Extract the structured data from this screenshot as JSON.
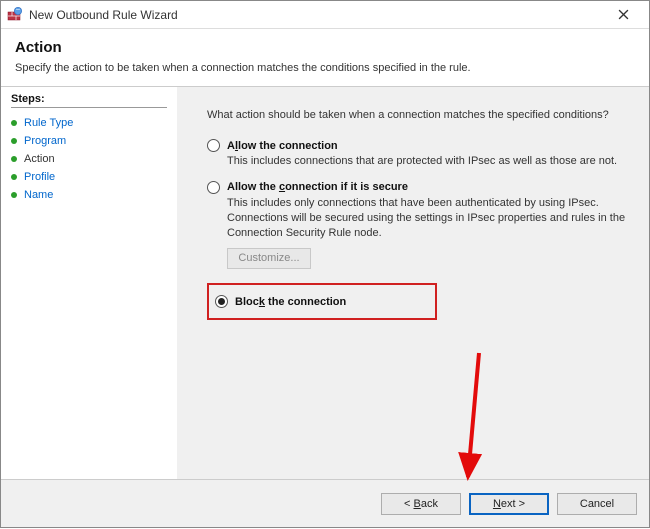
{
  "window": {
    "title": "New Outbound Rule Wizard"
  },
  "header": {
    "title": "Action",
    "subtitle": "Specify the action to be taken when a connection matches the conditions specified in the rule."
  },
  "sidebar": {
    "title": "Steps:",
    "items": [
      {
        "label": "Rule Type",
        "current": false
      },
      {
        "label": "Program",
        "current": false
      },
      {
        "label": "Action",
        "current": true
      },
      {
        "label": "Profile",
        "current": false
      },
      {
        "label": "Name",
        "current": false
      }
    ]
  },
  "main": {
    "question": "What action should be taken when a connection matches the specified conditions?",
    "options": {
      "allow": {
        "title_pre": "A",
        "title_accel": "l",
        "title_post": "low the connection",
        "desc": "This includes connections that are protected with IPsec as well as those are not."
      },
      "allow_secure": {
        "title_pre": "Allow the ",
        "title_accel": "c",
        "title_post": "onnection if it is secure",
        "desc": "This includes only connections that have been authenticated by using IPsec.  Connections will be secured using the settings in IPsec properties and rules in the Connection Security Rule node.",
        "customize": "Customize..."
      },
      "block": {
        "title_pre": "Bloc",
        "title_accel": "k",
        "title_post": " the connection"
      }
    }
  },
  "footer": {
    "back_pre": "< ",
    "back_accel": "B",
    "back_post": "ack",
    "next_accel": "N",
    "next_post": "ext >",
    "cancel": "Cancel"
  }
}
